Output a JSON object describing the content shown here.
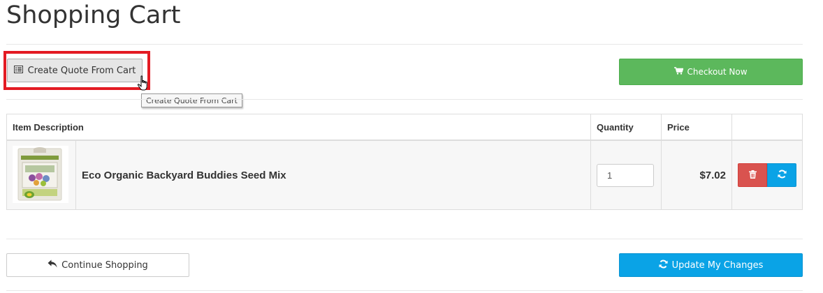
{
  "page": {
    "title": "Shopping Cart"
  },
  "toolbar": {
    "create_quote_label": "Create Quote From Cart",
    "create_quote_tooltip": "Create Quote From Cart",
    "checkout_label": "Checkout Now"
  },
  "table": {
    "headers": [
      "Item Description",
      "Quantity",
      "Price",
      ""
    ],
    "items": [
      {
        "description": "Eco Organic Backyard Buddies Seed Mix",
        "quantity": "1",
        "price": "$7.02",
        "thumbnail_icon": "seed-packet-image"
      }
    ]
  },
  "footer": {
    "continue_label": "Continue Shopping",
    "update_label": "Update My Changes"
  },
  "colors": {
    "checkout": "#5cb85c",
    "delete": "#d9534f",
    "update": "#0aa3e6",
    "highlight": "#e31b23"
  },
  "icons": {
    "quote": "list-alt-icon",
    "checkout": "shopping-cart-icon",
    "delete": "trash-icon",
    "update": "refresh-icon",
    "continue": "reply-arrow-icon",
    "cursor": "hand-pointer-cursor"
  }
}
